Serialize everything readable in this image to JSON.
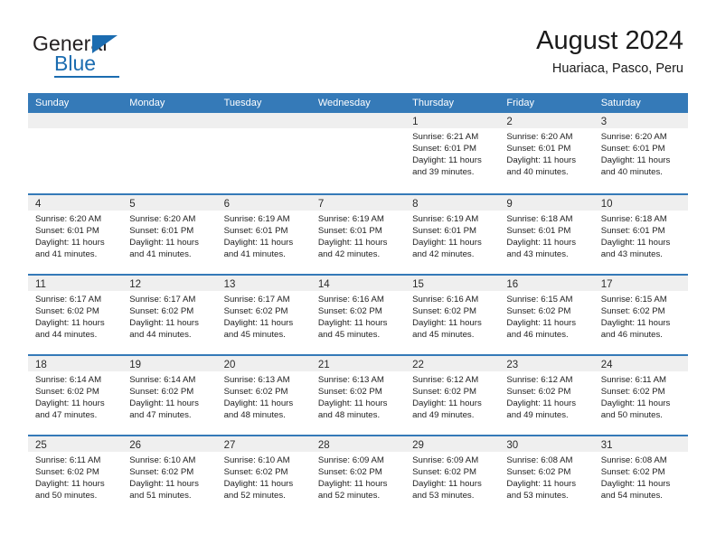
{
  "brand": {
    "name_part1": "General",
    "name_part2": "Blue",
    "accent_color": "#1b6cb0"
  },
  "header": {
    "title": "August 2024",
    "subtitle": "Huariaca, Pasco, Peru"
  },
  "calendar": {
    "header_bg": "#357ab8",
    "day_headers": [
      "Sunday",
      "Monday",
      "Tuesday",
      "Wednesday",
      "Thursday",
      "Friday",
      "Saturday"
    ],
    "weeks": [
      [
        {
          "day": "",
          "empty": true
        },
        {
          "day": "",
          "empty": true
        },
        {
          "day": "",
          "empty": true
        },
        {
          "day": "",
          "empty": true
        },
        {
          "day": "1",
          "sunrise": "Sunrise: 6:21 AM",
          "sunset": "Sunset: 6:01 PM",
          "daylight_line1": "Daylight: 11 hours",
          "daylight_line2": "and 39 minutes."
        },
        {
          "day": "2",
          "sunrise": "Sunrise: 6:20 AM",
          "sunset": "Sunset: 6:01 PM",
          "daylight_line1": "Daylight: 11 hours",
          "daylight_line2": "and 40 minutes."
        },
        {
          "day": "3",
          "sunrise": "Sunrise: 6:20 AM",
          "sunset": "Sunset: 6:01 PM",
          "daylight_line1": "Daylight: 11 hours",
          "daylight_line2": "and 40 minutes."
        }
      ],
      [
        {
          "day": "4",
          "sunrise": "Sunrise: 6:20 AM",
          "sunset": "Sunset: 6:01 PM",
          "daylight_line1": "Daylight: 11 hours",
          "daylight_line2": "and 41 minutes."
        },
        {
          "day": "5",
          "sunrise": "Sunrise: 6:20 AM",
          "sunset": "Sunset: 6:01 PM",
          "daylight_line1": "Daylight: 11 hours",
          "daylight_line2": "and 41 minutes."
        },
        {
          "day": "6",
          "sunrise": "Sunrise: 6:19 AM",
          "sunset": "Sunset: 6:01 PM",
          "daylight_line1": "Daylight: 11 hours",
          "daylight_line2": "and 41 minutes."
        },
        {
          "day": "7",
          "sunrise": "Sunrise: 6:19 AM",
          "sunset": "Sunset: 6:01 PM",
          "daylight_line1": "Daylight: 11 hours",
          "daylight_line2": "and 42 minutes."
        },
        {
          "day": "8",
          "sunrise": "Sunrise: 6:19 AM",
          "sunset": "Sunset: 6:01 PM",
          "daylight_line1": "Daylight: 11 hours",
          "daylight_line2": "and 42 minutes."
        },
        {
          "day": "9",
          "sunrise": "Sunrise: 6:18 AM",
          "sunset": "Sunset: 6:01 PM",
          "daylight_line1": "Daylight: 11 hours",
          "daylight_line2": "and 43 minutes."
        },
        {
          "day": "10",
          "sunrise": "Sunrise: 6:18 AM",
          "sunset": "Sunset: 6:01 PM",
          "daylight_line1": "Daylight: 11 hours",
          "daylight_line2": "and 43 minutes."
        }
      ],
      [
        {
          "day": "11",
          "sunrise": "Sunrise: 6:17 AM",
          "sunset": "Sunset: 6:02 PM",
          "daylight_line1": "Daylight: 11 hours",
          "daylight_line2": "and 44 minutes."
        },
        {
          "day": "12",
          "sunrise": "Sunrise: 6:17 AM",
          "sunset": "Sunset: 6:02 PM",
          "daylight_line1": "Daylight: 11 hours",
          "daylight_line2": "and 44 minutes."
        },
        {
          "day": "13",
          "sunrise": "Sunrise: 6:17 AM",
          "sunset": "Sunset: 6:02 PM",
          "daylight_line1": "Daylight: 11 hours",
          "daylight_line2": "and 45 minutes."
        },
        {
          "day": "14",
          "sunrise": "Sunrise: 6:16 AM",
          "sunset": "Sunset: 6:02 PM",
          "daylight_line1": "Daylight: 11 hours",
          "daylight_line2": "and 45 minutes."
        },
        {
          "day": "15",
          "sunrise": "Sunrise: 6:16 AM",
          "sunset": "Sunset: 6:02 PM",
          "daylight_line1": "Daylight: 11 hours",
          "daylight_line2": "and 45 minutes."
        },
        {
          "day": "16",
          "sunrise": "Sunrise: 6:15 AM",
          "sunset": "Sunset: 6:02 PM",
          "daylight_line1": "Daylight: 11 hours",
          "daylight_line2": "and 46 minutes."
        },
        {
          "day": "17",
          "sunrise": "Sunrise: 6:15 AM",
          "sunset": "Sunset: 6:02 PM",
          "daylight_line1": "Daylight: 11 hours",
          "daylight_line2": "and 46 minutes."
        }
      ],
      [
        {
          "day": "18",
          "sunrise": "Sunrise: 6:14 AM",
          "sunset": "Sunset: 6:02 PM",
          "daylight_line1": "Daylight: 11 hours",
          "daylight_line2": "and 47 minutes."
        },
        {
          "day": "19",
          "sunrise": "Sunrise: 6:14 AM",
          "sunset": "Sunset: 6:02 PM",
          "daylight_line1": "Daylight: 11 hours",
          "daylight_line2": "and 47 minutes."
        },
        {
          "day": "20",
          "sunrise": "Sunrise: 6:13 AM",
          "sunset": "Sunset: 6:02 PM",
          "daylight_line1": "Daylight: 11 hours",
          "daylight_line2": "and 48 minutes."
        },
        {
          "day": "21",
          "sunrise": "Sunrise: 6:13 AM",
          "sunset": "Sunset: 6:02 PM",
          "daylight_line1": "Daylight: 11 hours",
          "daylight_line2": "and 48 minutes."
        },
        {
          "day": "22",
          "sunrise": "Sunrise: 6:12 AM",
          "sunset": "Sunset: 6:02 PM",
          "daylight_line1": "Daylight: 11 hours",
          "daylight_line2": "and 49 minutes."
        },
        {
          "day": "23",
          "sunrise": "Sunrise: 6:12 AM",
          "sunset": "Sunset: 6:02 PM",
          "daylight_line1": "Daylight: 11 hours",
          "daylight_line2": "and 49 minutes."
        },
        {
          "day": "24",
          "sunrise": "Sunrise: 6:11 AM",
          "sunset": "Sunset: 6:02 PM",
          "daylight_line1": "Daylight: 11 hours",
          "daylight_line2": "and 50 minutes."
        }
      ],
      [
        {
          "day": "25",
          "sunrise": "Sunrise: 6:11 AM",
          "sunset": "Sunset: 6:02 PM",
          "daylight_line1": "Daylight: 11 hours",
          "daylight_line2": "and 50 minutes."
        },
        {
          "day": "26",
          "sunrise": "Sunrise: 6:10 AM",
          "sunset": "Sunset: 6:02 PM",
          "daylight_line1": "Daylight: 11 hours",
          "daylight_line2": "and 51 minutes."
        },
        {
          "day": "27",
          "sunrise": "Sunrise: 6:10 AM",
          "sunset": "Sunset: 6:02 PM",
          "daylight_line1": "Daylight: 11 hours",
          "daylight_line2": "and 52 minutes."
        },
        {
          "day": "28",
          "sunrise": "Sunrise: 6:09 AM",
          "sunset": "Sunset: 6:02 PM",
          "daylight_line1": "Daylight: 11 hours",
          "daylight_line2": "and 52 minutes."
        },
        {
          "day": "29",
          "sunrise": "Sunrise: 6:09 AM",
          "sunset": "Sunset: 6:02 PM",
          "daylight_line1": "Daylight: 11 hours",
          "daylight_line2": "and 53 minutes."
        },
        {
          "day": "30",
          "sunrise": "Sunrise: 6:08 AM",
          "sunset": "Sunset: 6:02 PM",
          "daylight_line1": "Daylight: 11 hours",
          "daylight_line2": "and 53 minutes."
        },
        {
          "day": "31",
          "sunrise": "Sunrise: 6:08 AM",
          "sunset": "Sunset: 6:02 PM",
          "daylight_line1": "Daylight: 11 hours",
          "daylight_line2": "and 54 minutes."
        }
      ]
    ]
  }
}
